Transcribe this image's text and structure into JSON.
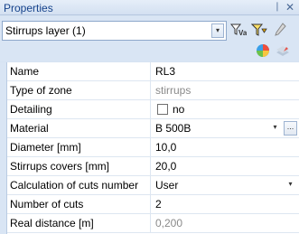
{
  "panel": {
    "title": "Properties",
    "pin_glyph": "❘",
    "close_glyph": "✕"
  },
  "toolbar": {
    "selector_value": "Stirrups layer (1)",
    "selector_arrow": "▾",
    "icons": [
      "filter-with-value-icon",
      "filter-with-funnel-icon",
      "pencil-icon",
      "colors-pie-icon",
      "layers-icon"
    ]
  },
  "properties": [
    {
      "name": "Name",
      "value": "RL3"
    },
    {
      "name": "Type of zone",
      "value": "stirrups",
      "readonly": true
    },
    {
      "name": "Detailing",
      "value": "no",
      "checkbox": true,
      "checked": false
    },
    {
      "name": "Material",
      "value": "B 500B",
      "dropdown": true,
      "ellipsis": "..."
    },
    {
      "name": "Diameter [mm]",
      "value": "10,0"
    },
    {
      "name": "Stirrups covers [mm]",
      "value": "20,0"
    },
    {
      "name": "Calculation of cuts number",
      "value": "User",
      "dropdown": true
    },
    {
      "name": "Number of cuts",
      "value": "2"
    },
    {
      "name": "Real distance [m]",
      "value": "0,200",
      "readonly": true
    }
  ],
  "glyphs": {
    "dropdown_arrow": "▾"
  }
}
